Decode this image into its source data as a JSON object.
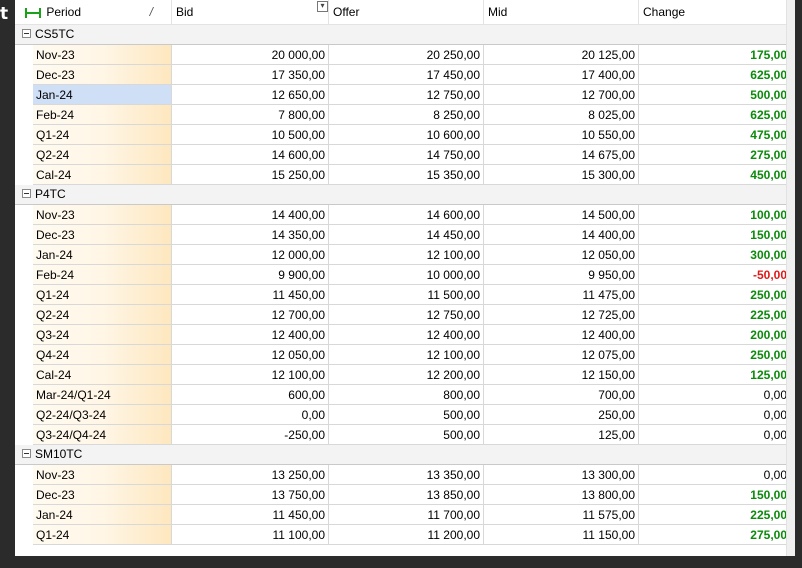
{
  "columns": {
    "period": "Period",
    "sort_indicator": "/",
    "bid": "Bid",
    "offer": "Offer",
    "mid": "Mid",
    "change": "Change"
  },
  "groups": [
    {
      "name": "CS5TC",
      "rows": [
        {
          "period": "Nov-23",
          "bid": "20 000,00",
          "offer": "20 250,00",
          "mid": "20 125,00",
          "change": "175,00",
          "dir": "pos"
        },
        {
          "period": "Dec-23",
          "bid": "17 350,00",
          "offer": "17 450,00",
          "mid": "17 400,00",
          "change": "625,00",
          "dir": "pos"
        },
        {
          "period": "Jan-24",
          "bid": "12 650,00",
          "offer": "12 750,00",
          "mid": "12 700,00",
          "change": "500,00",
          "dir": "pos",
          "selected": true
        },
        {
          "period": "Feb-24",
          "bid": "7 800,00",
          "offer": "8 250,00",
          "mid": "8 025,00",
          "change": "625,00",
          "dir": "pos"
        },
        {
          "period": "Q1-24",
          "bid": "10 500,00",
          "offer": "10 600,00",
          "mid": "10 550,00",
          "change": "475,00",
          "dir": "pos"
        },
        {
          "period": "Q2-24",
          "bid": "14 600,00",
          "offer": "14 750,00",
          "mid": "14 675,00",
          "change": "275,00",
          "dir": "pos"
        },
        {
          "period": "Cal-24",
          "bid": "15 250,00",
          "offer": "15 350,00",
          "mid": "15 300,00",
          "change": "450,00",
          "dir": "pos"
        }
      ]
    },
    {
      "name": "P4TC",
      "rows": [
        {
          "period": "Nov-23",
          "bid": "14 400,00",
          "offer": "14 600,00",
          "mid": "14 500,00",
          "change": "100,00",
          "dir": "pos"
        },
        {
          "period": "Dec-23",
          "bid": "14 350,00",
          "offer": "14 450,00",
          "mid": "14 400,00",
          "change": "150,00",
          "dir": "pos"
        },
        {
          "period": "Jan-24",
          "bid": "12 000,00",
          "offer": "12 100,00",
          "mid": "12 050,00",
          "change": "300,00",
          "dir": "pos"
        },
        {
          "period": "Feb-24",
          "bid": "9 900,00",
          "offer": "10 000,00",
          "mid": "9 950,00",
          "change": "-50,00",
          "dir": "neg"
        },
        {
          "period": "Q1-24",
          "bid": "11 450,00",
          "offer": "11 500,00",
          "mid": "11 475,00",
          "change": "250,00",
          "dir": "pos"
        },
        {
          "period": "Q2-24",
          "bid": "12 700,00",
          "offer": "12 750,00",
          "mid": "12 725,00",
          "change": "225,00",
          "dir": "pos"
        },
        {
          "period": "Q3-24",
          "bid": "12 400,00",
          "offer": "12 400,00",
          "mid": "12 400,00",
          "change": "200,00",
          "dir": "pos"
        },
        {
          "period": "Q4-24",
          "bid": "12 050,00",
          "offer": "12 100,00",
          "mid": "12 075,00",
          "change": "250,00",
          "dir": "pos"
        },
        {
          "period": "Cal-24",
          "bid": "12 100,00",
          "offer": "12 200,00",
          "mid": "12 150,00",
          "change": "125,00",
          "dir": "pos"
        },
        {
          "period": "Mar-24/Q1-24",
          "bid": "600,00",
          "offer": "800,00",
          "mid": "700,00",
          "change": "0,00",
          "dir": "zero"
        },
        {
          "period": "Q2-24/Q3-24",
          "bid": "0,00",
          "offer": "500,00",
          "mid": "250,00",
          "change": "0,00",
          "dir": "zero"
        },
        {
          "period": "Q3-24/Q4-24",
          "bid": "-250,00",
          "offer": "500,00",
          "mid": "125,00",
          "change": "0,00",
          "dir": "zero"
        }
      ]
    },
    {
      "name": "SM10TC",
      "rows": [
        {
          "period": "Nov-23",
          "bid": "13 250,00",
          "offer": "13 350,00",
          "mid": "13 300,00",
          "change": "0,00",
          "dir": "zero"
        },
        {
          "period": "Dec-23",
          "bid": "13 750,00",
          "offer": "13 850,00",
          "mid": "13 800,00",
          "change": "150,00",
          "dir": "pos"
        },
        {
          "period": "Jan-24",
          "bid": "11 450,00",
          "offer": "11 700,00",
          "mid": "11 575,00",
          "change": "225,00",
          "dir": "pos"
        },
        {
          "period": "Q1-24",
          "bid": "11 100,00",
          "offer": "11 200,00",
          "mid": "11 150,00",
          "change": "275,00",
          "dir": "pos"
        }
      ]
    }
  ],
  "colors": {
    "positive": "#0b8a0b",
    "negative": "#e01818",
    "selected": "#cfdff5",
    "group_icon": "#1aa31a"
  }
}
